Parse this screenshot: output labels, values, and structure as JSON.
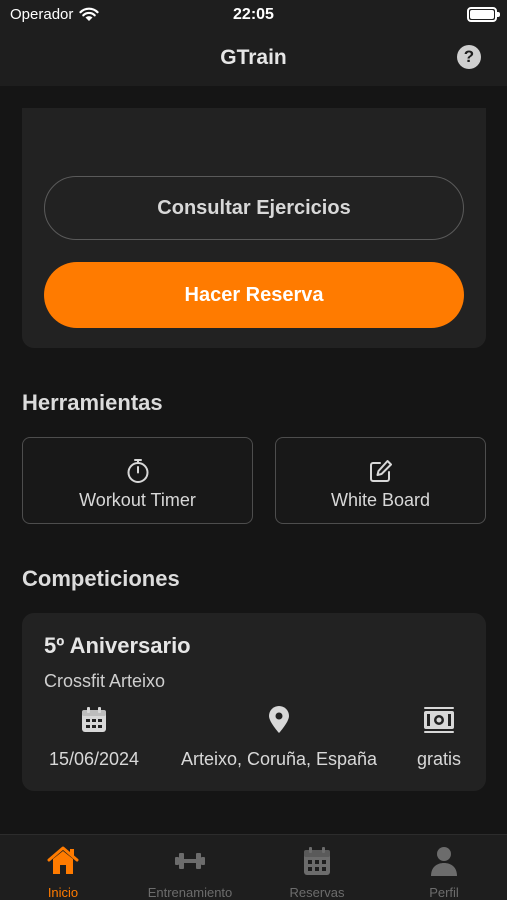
{
  "status_bar": {
    "carrier": "Operador",
    "time": "22:05"
  },
  "nav": {
    "title": "GTrain",
    "help_label": "?"
  },
  "actions": {
    "consult_label": "Consultar Ejercicios",
    "reserve_label": "Hacer Reserva"
  },
  "tools": {
    "title": "Herramientas",
    "items": [
      {
        "label": "Workout Timer",
        "icon": "stopwatch-icon"
      },
      {
        "label": "White Board",
        "icon": "edit-icon"
      }
    ]
  },
  "competitions": {
    "title": "Competiciones",
    "items": [
      {
        "name": "5º Aniversario",
        "box": "Crossfit Arteixo",
        "date": "15/06/2024",
        "location": "Arteixo, Coruña, España",
        "price": "gratis"
      }
    ]
  },
  "tabs": [
    {
      "label": "Inicio",
      "icon": "home-icon",
      "active": true
    },
    {
      "label": "Entrenamiento",
      "icon": "dumbbell-icon",
      "active": false
    },
    {
      "label": "Reservas",
      "icon": "calendar-icon",
      "active": false
    },
    {
      "label": "Perfil",
      "icon": "person-icon",
      "active": false
    }
  ],
  "colors": {
    "accent": "#ff7b00",
    "background": "#151515",
    "card": "#222222",
    "bar": "#1e1e1e"
  }
}
